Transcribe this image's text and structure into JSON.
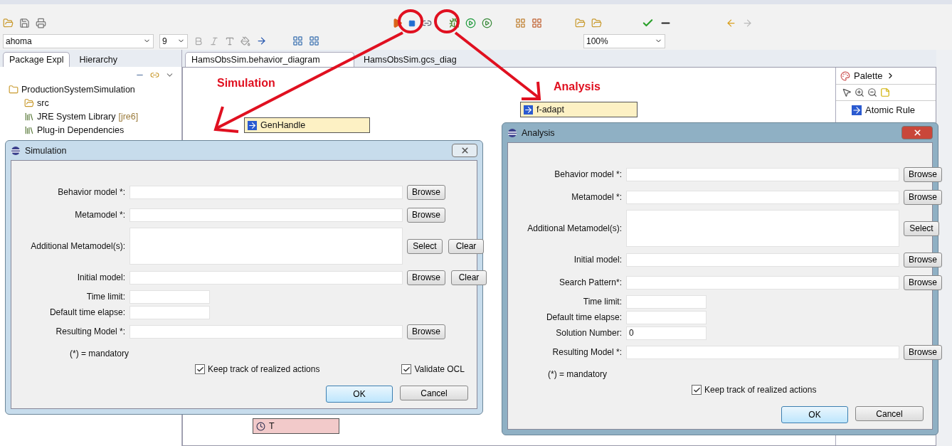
{
  "toolbar": {
    "font_field": "ahoma",
    "size_field": "9",
    "zoom_field": "100%"
  },
  "left_tabs": [
    {
      "label": "Package Expl",
      "selected": true
    },
    {
      "label": "Hierarchy",
      "selected": false
    }
  ],
  "tree": [
    {
      "label": "ProductionSystemSimulation",
      "children": [
        {
          "label": "src",
          "kind": "folder"
        },
        {
          "label": "JRE System Library",
          "suffix": "[jre6]",
          "kind": "library"
        },
        {
          "label": "Plug-in Dependencies",
          "kind": "library"
        }
      ],
      "kind": "project"
    }
  ],
  "editor_tabs": [
    {
      "label": "HamsObsSim.behavior_diagram",
      "selected": true
    },
    {
      "label": "HamsObsSim.gcs_diag",
      "selected": false
    }
  ],
  "diagram_nodes": [
    {
      "label": "GenHandle",
      "kind": "rule"
    },
    {
      "label": "f-adapt",
      "kind": "rule"
    },
    {
      "label": "T",
      "kind": "timer"
    }
  ],
  "palette": {
    "title": "Palette",
    "items": [
      "Atomic Rule"
    ]
  },
  "annotations": [
    "Simulation",
    "Analysis"
  ],
  "dialogs": [
    {
      "title": "Simulation",
      "active": false,
      "fields": [
        {
          "label": "Behavior model *:",
          "kind": "text",
          "buttons": [
            "Browse"
          ]
        },
        {
          "label": "Metamodel *:",
          "kind": "text",
          "buttons": [
            "Browse"
          ]
        },
        {
          "label": "Additional Metamodel(s):",
          "kind": "list",
          "buttons": [
            "Select",
            "Clear"
          ]
        },
        {
          "label": "Initial model:",
          "kind": "text",
          "buttons": [
            "Browse",
            "Clear"
          ]
        },
        {
          "label": "Time limit:",
          "kind": "short"
        },
        {
          "label": "Default time elapse:",
          "kind": "short"
        },
        {
          "label": "Resulting Model *:",
          "kind": "text",
          "buttons": [
            "Browse"
          ]
        }
      ],
      "note": "(*) = mandatory",
      "checkboxes": [
        {
          "label": "Keep track of realized actions",
          "checked": true
        },
        {
          "label": "Validate OCL",
          "checked": true
        }
      ],
      "ok": "OK",
      "cancel": "Cancel"
    },
    {
      "title": "Analysis",
      "active": true,
      "fields": [
        {
          "label": "Behavior model *:",
          "kind": "text",
          "buttons": [
            "Browse"
          ]
        },
        {
          "label": "Metamodel *:",
          "kind": "text",
          "buttons": [
            "Browse"
          ]
        },
        {
          "label": "Additional Metamodel(s):",
          "kind": "list",
          "buttons": [
            "Select"
          ]
        },
        {
          "label": "Initial model:",
          "kind": "text",
          "buttons": [
            "Browse"
          ]
        },
        {
          "label": "Search Pattern*:",
          "kind": "text",
          "buttons": [
            "Browse"
          ]
        },
        {
          "label": "Time limit:",
          "kind": "short"
        },
        {
          "label": "Default time elapse:",
          "kind": "short"
        },
        {
          "label": "Solution Number:",
          "kind": "short",
          "value": "0"
        },
        {
          "label": "Resulting Model *:",
          "kind": "text",
          "buttons": [
            "Browse"
          ]
        }
      ],
      "note": "(*) = mandatory",
      "checkboxes": [
        {
          "label": "Keep track of realized actions",
          "checked": true
        }
      ],
      "ok": "OK",
      "cancel": "Cancel"
    }
  ]
}
